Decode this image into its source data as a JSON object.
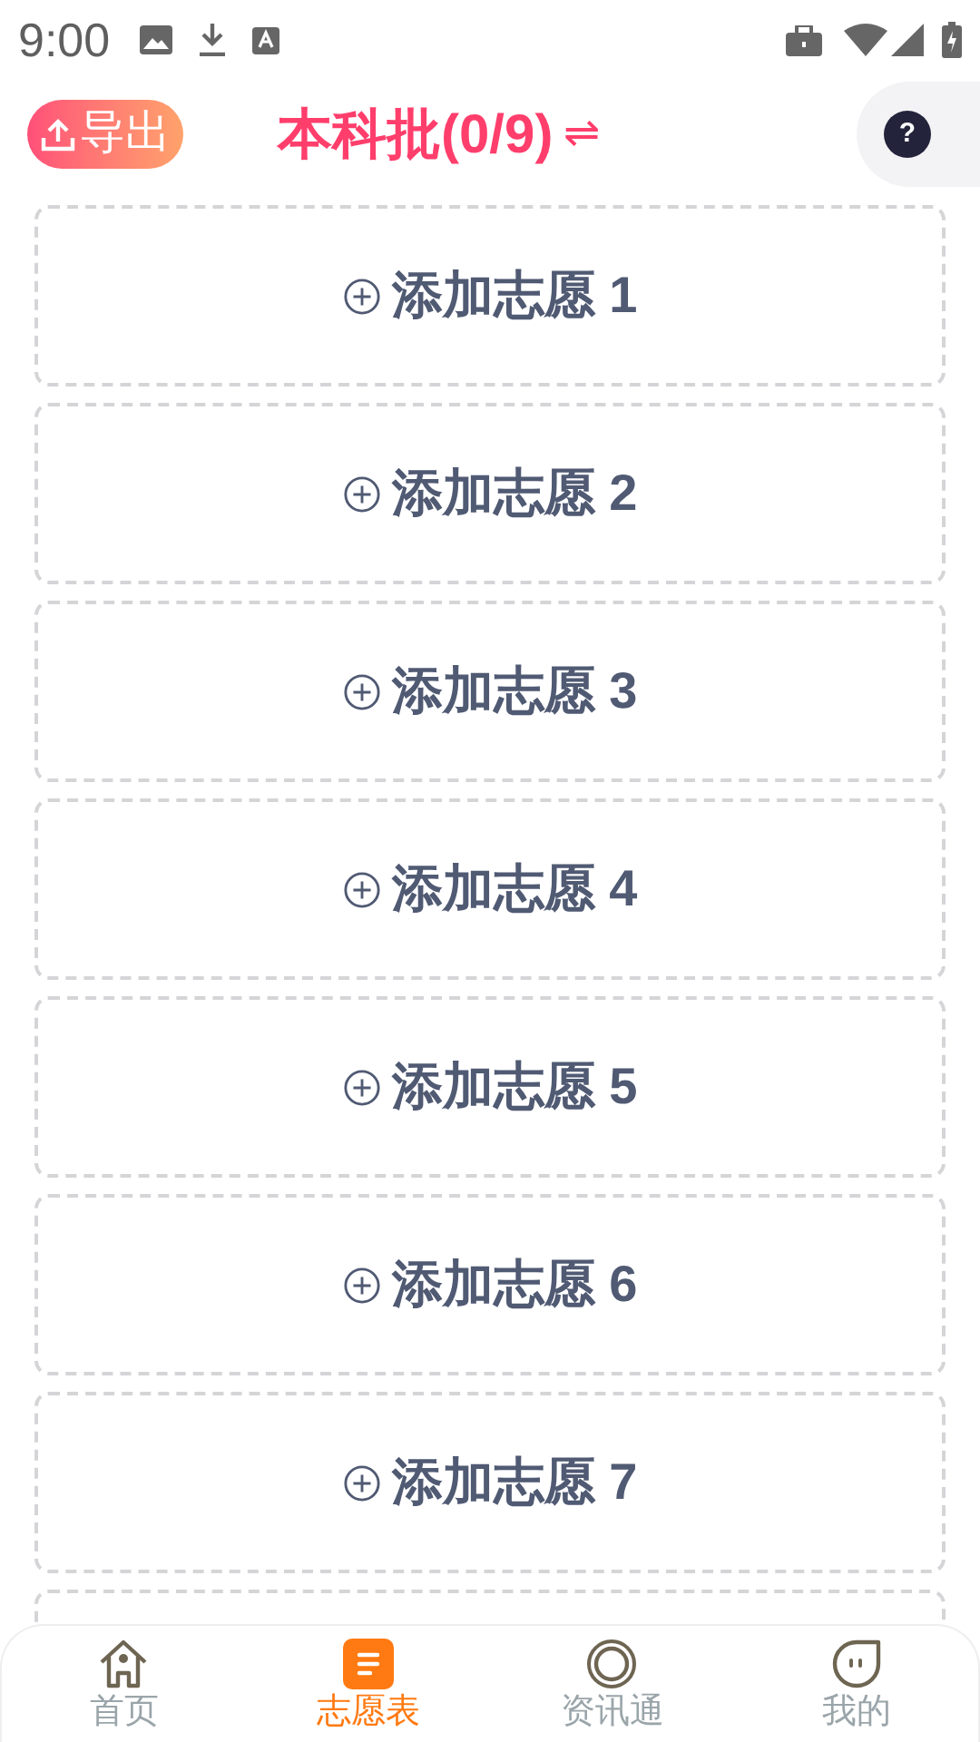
{
  "status_bar": {
    "time": "9:00"
  },
  "header": {
    "export_button": "导出",
    "title": "本科批(0/9)",
    "switch_icon": "⇌",
    "help_button": "?"
  },
  "slots": [
    {
      "label": "添加志愿 1"
    },
    {
      "label": "添加志愿 2"
    },
    {
      "label": "添加志愿 3"
    },
    {
      "label": "添加志愿 4"
    },
    {
      "label": "添加志愿 5"
    },
    {
      "label": "添加志愿 6"
    },
    {
      "label": "添加志愿 7"
    }
  ],
  "bottom_nav": [
    {
      "label": "首页",
      "kind": "home",
      "selected": false
    },
    {
      "label": "志愿表",
      "kind": "list",
      "selected": true
    },
    {
      "label": "资讯通",
      "kind": "news",
      "selected": false
    },
    {
      "label": "我的",
      "kind": "me",
      "selected": false
    }
  ]
}
